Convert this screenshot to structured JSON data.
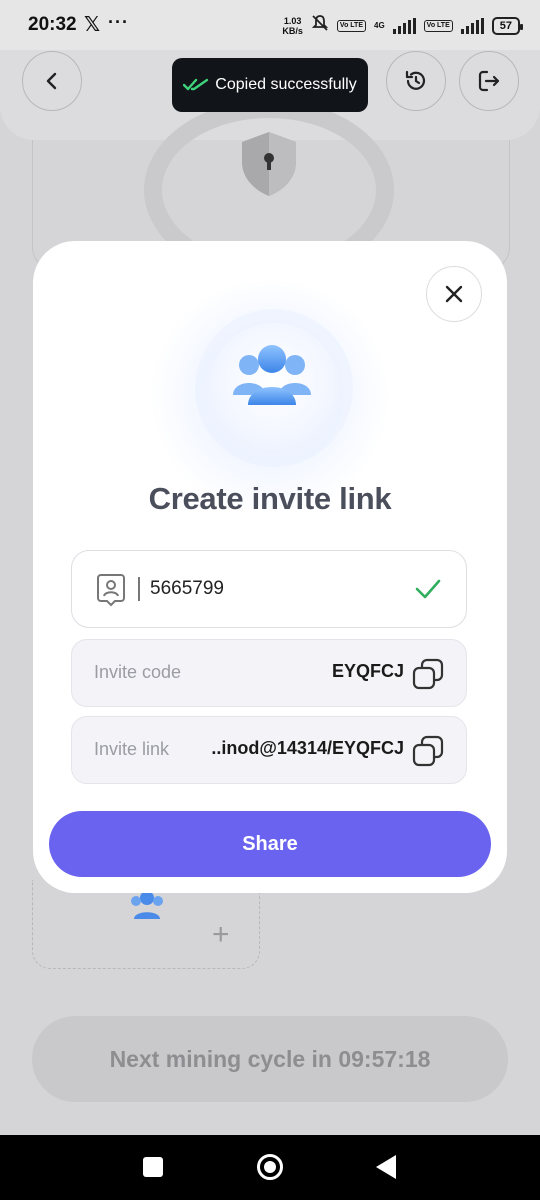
{
  "status_bar": {
    "time": "20:32",
    "x_glyph": "𝕏",
    "more": "···",
    "speed_value": "1.03",
    "speed_unit": "KB/s",
    "chip1": "Vo LTE",
    "net_type": "4G",
    "chip2": "Vo LTE",
    "battery": "57"
  },
  "toast": {
    "text": "Copied successfully",
    "icon": "double-check-icon"
  },
  "background": {
    "mining_text": "Next mining cycle in 09:57:18"
  },
  "modal": {
    "title": "Create invite link",
    "user_id": "5665799",
    "invite_code": {
      "label": "Invite code",
      "value": "EYQFCJ"
    },
    "invite_link": {
      "label": "Invite link",
      "value": "..inod@14314/EYQFCJ"
    },
    "share_label": "Share"
  },
  "colors": {
    "accent": "#6a63ef",
    "toast_bg": "#111419",
    "check_green": "#2fae5e",
    "title": "#4b4f5c"
  }
}
